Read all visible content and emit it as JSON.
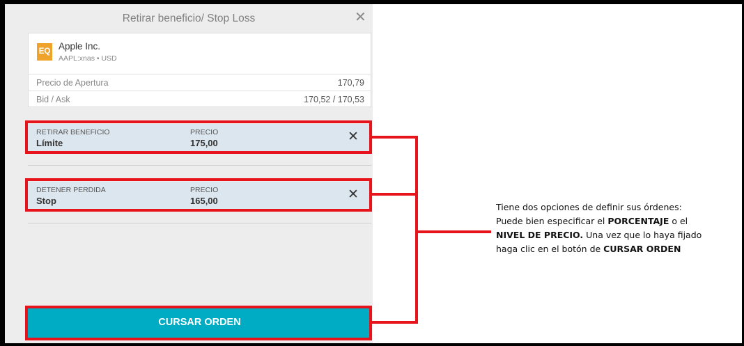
{
  "panel": {
    "title": "Retirar beneficio/ Stop Loss",
    "close_glyph": "✕"
  },
  "instrument": {
    "badge": "EQ",
    "name": "Apple Inc.",
    "ticker": "AAPL:xnas • USD",
    "rows": [
      {
        "label": "Precio de Apertura",
        "value": "170,79"
      },
      {
        "label": "Bid / Ask",
        "value": "170,52 / 170,53"
      }
    ]
  },
  "orders": [
    {
      "type_header": "RETIRAR BENEFICIO",
      "type_value": "Límite",
      "price_header": "PRECIO",
      "price_value": "175,00",
      "remove_glyph": "✕"
    },
    {
      "type_header": "DETENER PERDIDA",
      "type_value": "Stop",
      "price_header": "PRECIO",
      "price_value": "165,00",
      "remove_glyph": "✕"
    }
  ],
  "submit": {
    "label": "CURSAR ORDEN"
  },
  "annotation": {
    "line1": "Tiene dos opciones de definir sus órdenes:",
    "line2_a": "Puede bien especificar el ",
    "line2_b": "PORCENTAJE",
    "line2_c": " o el",
    "line3_a": "NIVEL DE PRECIO.",
    "line3_b": " Una vez que lo haya fijado",
    "line4_a": "haga clic en el botón de ",
    "line4_b": "CURSAR ORDEN"
  },
  "colors": {
    "highlight": "#e8141c",
    "submit_bg": "#00acc4",
    "badge_bg": "#f0a32b",
    "order_bg": "#dce6ee"
  }
}
